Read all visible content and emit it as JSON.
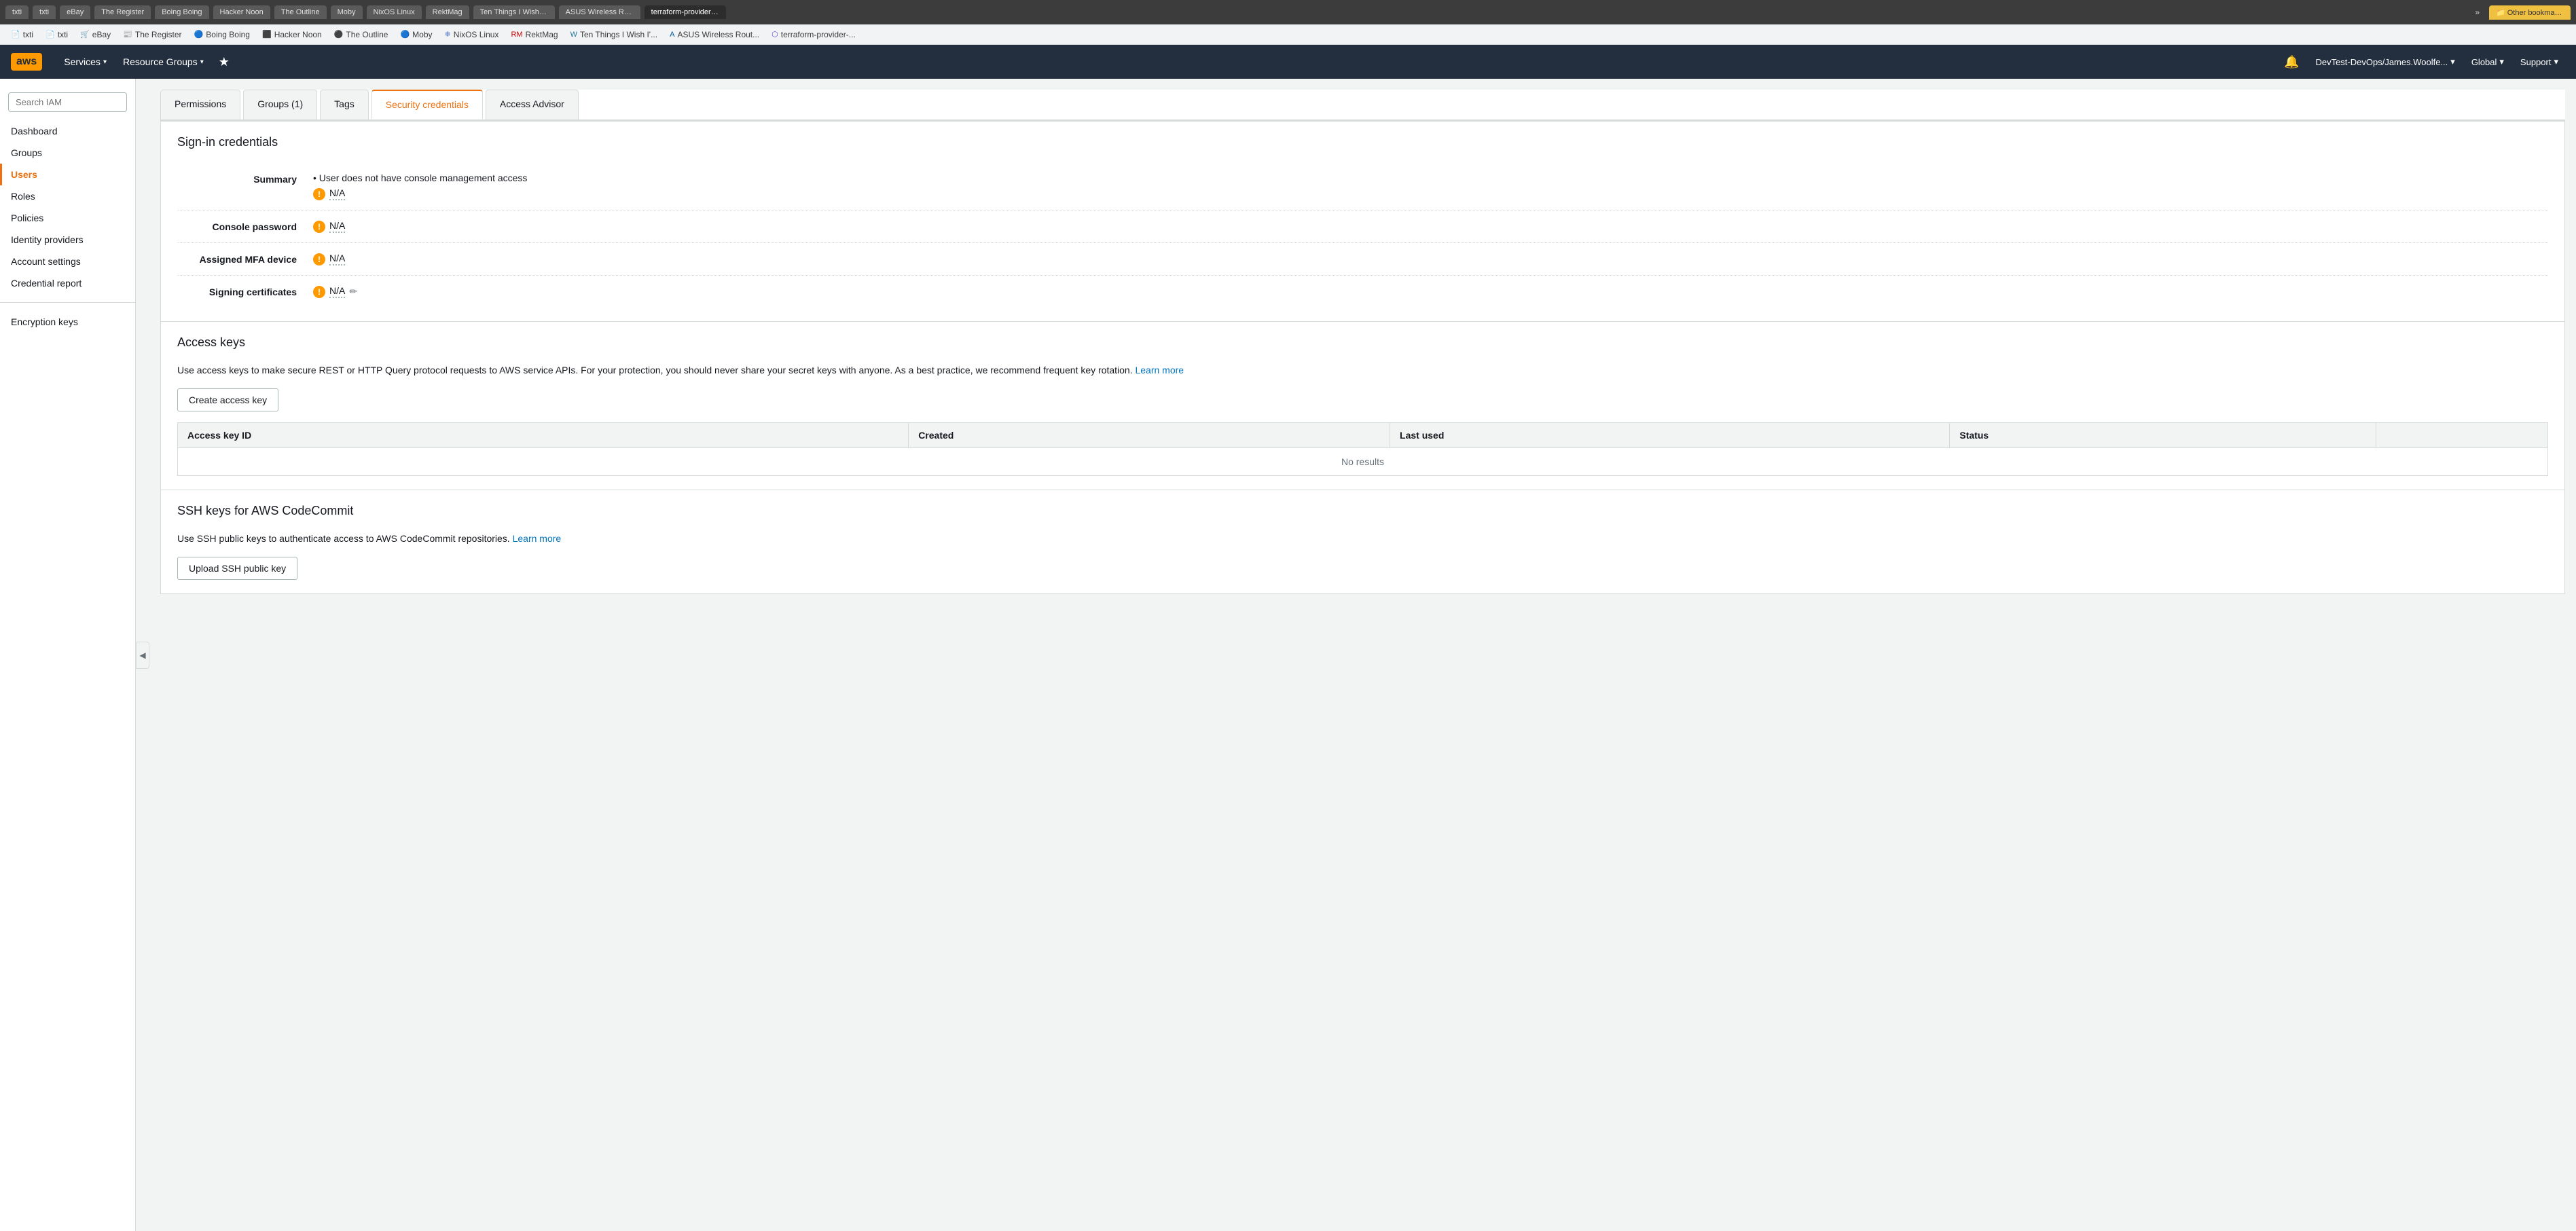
{
  "browser": {
    "tabs": [
      {
        "label": "txti",
        "active": false
      },
      {
        "label": "txti",
        "active": false
      },
      {
        "label": "eBay",
        "active": false
      },
      {
        "label": "The Register",
        "active": false
      },
      {
        "label": "Boing Boing",
        "active": false
      },
      {
        "label": "Hacker Noon",
        "active": false
      },
      {
        "label": "The Outline",
        "active": false
      },
      {
        "label": "Moby",
        "active": false
      },
      {
        "label": "NixOS Linux",
        "active": false
      },
      {
        "label": "RektMag",
        "active": false
      },
      {
        "label": "Ten Things I Wish I'...",
        "active": false
      },
      {
        "label": "ASUS Wireless Rout...",
        "active": false
      },
      {
        "label": "terraform-provider-...",
        "active": true
      },
      {
        "label": "Other bookmarks",
        "active": false
      }
    ]
  },
  "bookmarks": [
    {
      "label": "txti",
      "color": "#888"
    },
    {
      "label": "txti",
      "color": "#888"
    },
    {
      "label": "eBay",
      "color": "#e53238"
    },
    {
      "label": "The Register",
      "color": "#c00"
    },
    {
      "label": "Boing Boing",
      "color": "#e62"
    },
    {
      "label": "Hacker Noon",
      "color": "#222"
    },
    {
      "label": "The Outline",
      "color": "#000"
    },
    {
      "label": "Moby",
      "color": "#333"
    },
    {
      "label": "NixOS Linux",
      "color": "#5277c3"
    },
    {
      "label": "RektMag",
      "color": "#c00"
    },
    {
      "label": "Ten Things I Wish I'...",
      "color": "#21759b"
    },
    {
      "label": "ASUS Wireless Rout...",
      "color": "#00599d"
    },
    {
      "label": "terraform-provider-...",
      "color": "#5c4ee5"
    },
    {
      "label": "Other bookmarks",
      "color": "#e8a000"
    }
  ],
  "header": {
    "services_label": "Services",
    "resource_groups_label": "Resource Groups",
    "bell_icon": "🔔",
    "account_label": "DevTest-DevOps/James.Woolfe...",
    "region_label": "Global",
    "support_label": "Support"
  },
  "sidebar": {
    "search_placeholder": "Search IAM",
    "items": [
      {
        "label": "Dashboard",
        "active": false
      },
      {
        "label": "Groups",
        "active": false
      },
      {
        "label": "Users",
        "active": true
      },
      {
        "label": "Roles",
        "active": false
      },
      {
        "label": "Policies",
        "active": false
      },
      {
        "label": "Identity providers",
        "active": false
      },
      {
        "label": "Account settings",
        "active": false
      },
      {
        "label": "Credential report",
        "active": false
      }
    ],
    "items2": [
      {
        "label": "Encryption keys",
        "active": false
      }
    ]
  },
  "tabs": [
    {
      "label": "Permissions",
      "active": false
    },
    {
      "label": "Groups (1)",
      "active": false
    },
    {
      "label": "Tags",
      "active": false
    },
    {
      "label": "Security credentials",
      "active": true
    },
    {
      "label": "Access Advisor",
      "active": false
    }
  ],
  "sign_in": {
    "title": "Sign-in credentials",
    "summary_label": "Summary",
    "summary_bullet": "User does not have console management access",
    "summary_warning_na": "N/A",
    "console_password_label": "Console password",
    "console_password_value": "N/A",
    "mfa_label": "Assigned MFA device",
    "mfa_value": "N/A",
    "signing_certs_label": "Signing certificates",
    "signing_certs_value": "N/A"
  },
  "access_keys": {
    "title": "Access keys",
    "description": "Use access keys to make secure REST or HTTP Query protocol requests to AWS service APIs. For your protection, you should never share your secret keys with anyone. As a best practice, we recommend frequent key rotation.",
    "learn_more": "Learn more",
    "create_button": "Create access key",
    "table_headers": [
      {
        "label": "Access key ID"
      },
      {
        "label": "Created"
      },
      {
        "label": "Last used"
      },
      {
        "label": "Status"
      },
      {
        "label": ""
      }
    ],
    "no_results": "No results"
  },
  "ssh_section": {
    "title": "SSH keys for AWS CodeCommit",
    "description": "Use SSH public keys to authenticate access to AWS CodeCommit repositories.",
    "learn_more": "Learn more",
    "upload_button": "Upload SSH public key"
  }
}
